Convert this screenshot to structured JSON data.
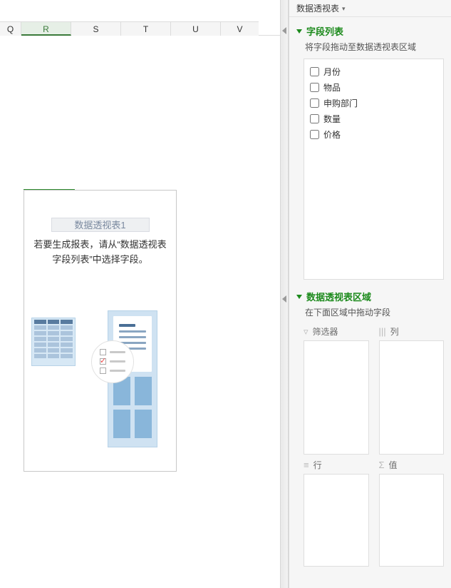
{
  "panel_title": "数据透视表",
  "columns": [
    "Q",
    "R",
    "S",
    "T",
    "U",
    "V"
  ],
  "selected_column": "R",
  "pivot_placeholder": {
    "title": "数据透视表1",
    "hint": "若要生成报表，请从“数据透视表字段列表”中选择字段。"
  },
  "field_list": {
    "heading": "字段列表",
    "sub": "将字段拖动至数据透视表区域",
    "fields": [
      "月份",
      "物品",
      "申购部门",
      "数量",
      "价格"
    ]
  },
  "areas": {
    "heading": "数据透视表区域",
    "sub": "在下面区域中拖动字段",
    "filter_label": "筛选器",
    "columns_label": "列",
    "rows_label": "行",
    "values_label": "值"
  }
}
